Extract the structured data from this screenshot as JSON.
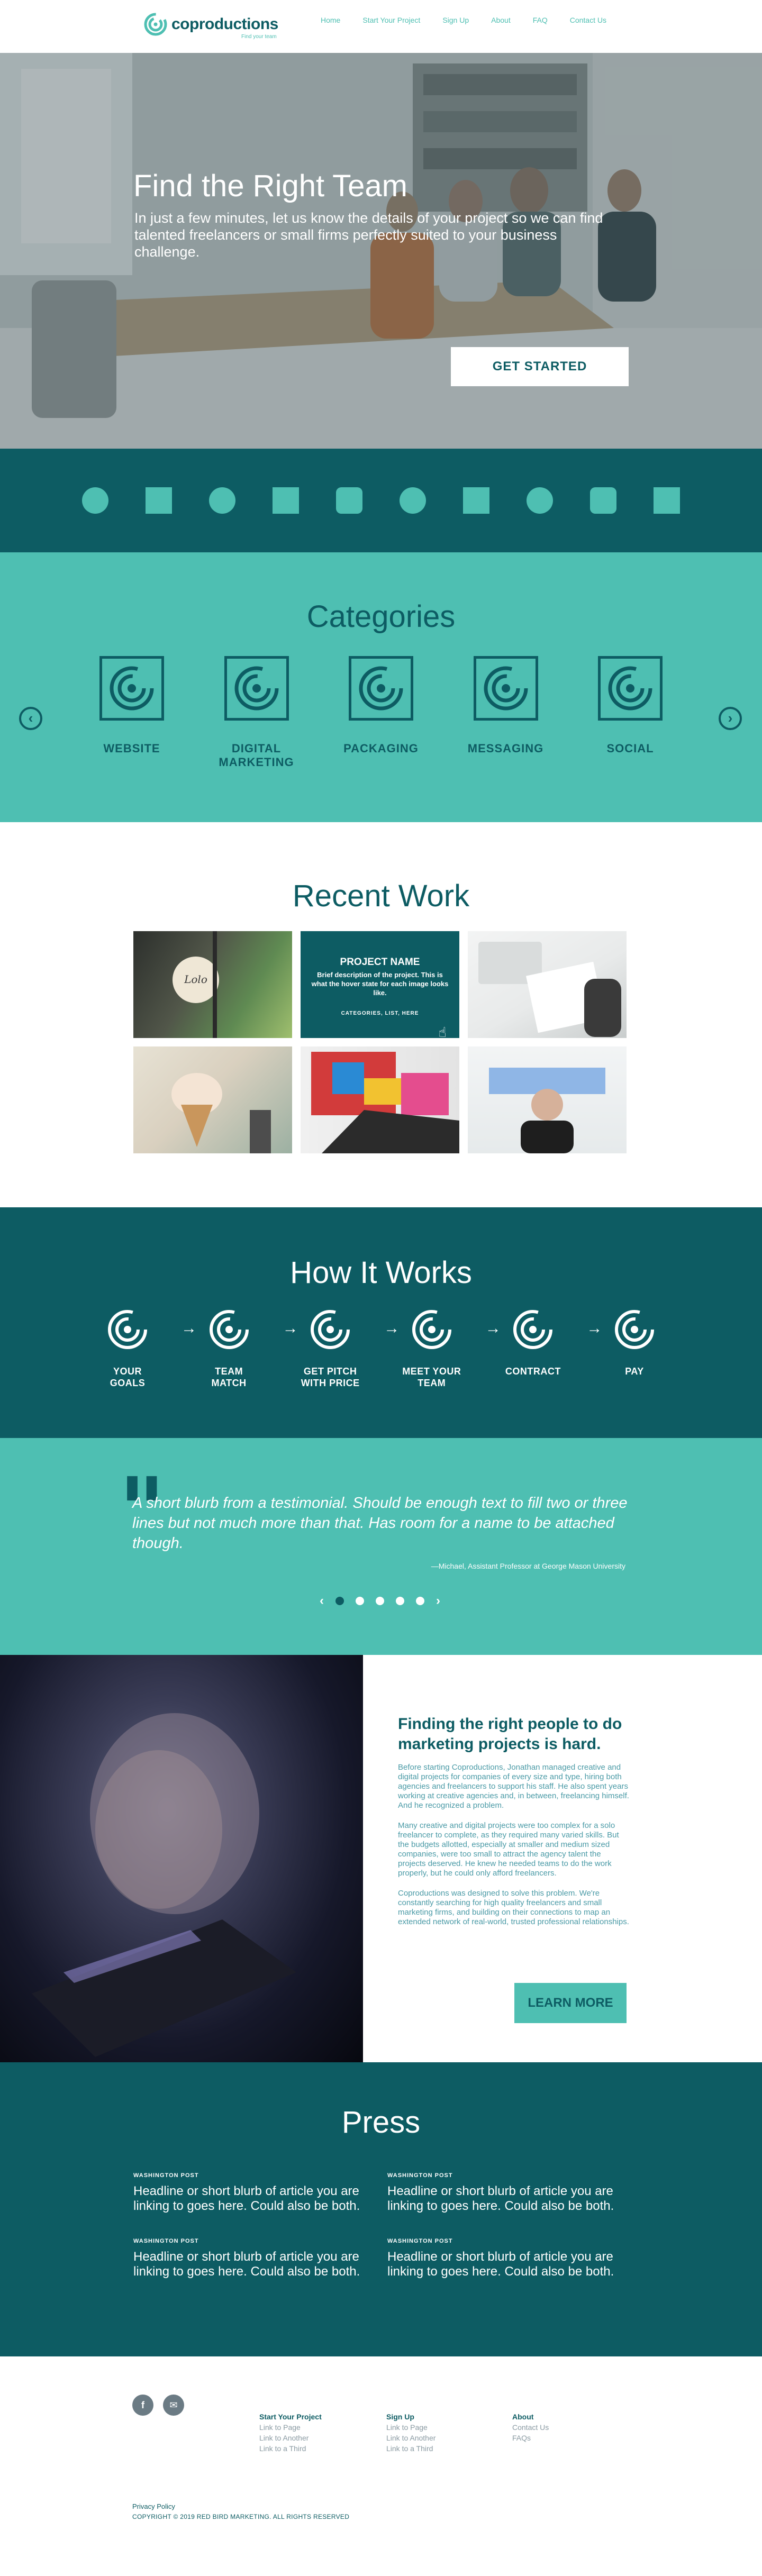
{
  "brand": {
    "name": "coproductions",
    "tagline": "Find your team",
    "color_dark": "#0d5c63",
    "color_accent": "#4ebfb2"
  },
  "nav": {
    "items": [
      "Home",
      "Start Your Project",
      "Sign Up",
      "About",
      "FAQ",
      "Contact Us"
    ]
  },
  "hero": {
    "title": "Find the Right Team",
    "subtitle": "In just a few minutes, let us know the details of your project so we can find talented freelancers or small firms perfectly suited to your business challenge.",
    "cta": "GET STARTED"
  },
  "shapes_band": {
    "icons": [
      "circle",
      "square",
      "circle",
      "square",
      "rounded-square",
      "circle",
      "square",
      "circle",
      "rounded-square",
      "square"
    ]
  },
  "categories": {
    "title": "Categories",
    "items": [
      "WEBSITE",
      "DIGITAL\nMARKETING",
      "PACKAGING",
      "MESSAGING",
      "SOCIAL"
    ],
    "prev_icon": "chevron-left-icon",
    "next_icon": "chevron-right-icon"
  },
  "recent_work": {
    "title": "Recent Work",
    "featured": {
      "name": "PROJECT NAME",
      "description": "Brief description of the project. This is what the hover state for each image looks like.",
      "categories": "CATEGORIES, LIST, HERE"
    }
  },
  "how_it_works": {
    "title": "How It Works",
    "steps": [
      "YOUR\nGOALS",
      "TEAM\nMATCH",
      "GET PITCH\nWITH PRICE",
      "MEET YOUR\nTEAM",
      "CONTRACT",
      "PAY"
    ]
  },
  "testimonial": {
    "quote": "A short blurb from a testimonial. Should be enough text to fill two or three lines but not much more than that. Has room for a name to be attached though.",
    "author": "—Michael, Assistant Professor at George Mason University",
    "slides": 5,
    "active_slide": 1
  },
  "story": {
    "title": "Finding the right people to do marketing projects is hard.",
    "paragraphs": [
      "Before starting Coproductions, Jonathan managed creative and digital projects for companies of every size and type, hiring both agencies and freelancers to support his staff. He also spent years working at creative agencies and, in between, freelancing himself. And he recognized a problem.",
      "Many creative and digital projects were too complex for a solo freelancer to complete, as they required many varied skills. But the budgets allotted, especially at smaller and medium sized companies, were too small to attract the agency talent the projects deserved. He knew he needed teams to do the work properly, but he could only afford freelancers.",
      "Coproductions was designed to solve this problem. We're constantly searching for high quality freelancers and small marketing firms, and building on their connections to map an extended network of real-world, trusted professional relationships."
    ],
    "cta": "LEARN MORE"
  },
  "press": {
    "title": "Press",
    "items": [
      {
        "source": "WASHINGTON POST",
        "headline": "Headline or short blurb of article you are linking to goes here. Could also be both."
      },
      {
        "source": "WASHINGTON POST",
        "headline": "Headline or short blurb of article you are linking to goes here. Could also be both."
      },
      {
        "source": "WASHINGTON POST",
        "headline": "Headline or short blurb of article you are linking to goes here. Could also be both."
      },
      {
        "source": "WASHINGTON POST",
        "headline": "Headline or short blurb of article you are linking to goes here. Could also be both."
      }
    ]
  },
  "footer": {
    "social": [
      "f",
      "✉"
    ],
    "columns": [
      {
        "heading": "Start Your Project",
        "links": [
          "Link to Page",
          "Link to Another",
          "Link to a Third"
        ]
      },
      {
        "heading": "Sign Up",
        "links": [
          "Link to Page",
          "Link to Another",
          "Link to a Third"
        ]
      },
      {
        "heading": "About",
        "links": [
          "Contact Us",
          "FAQs"
        ]
      }
    ],
    "privacy": "Privacy Policy",
    "copyright": "COPYRIGHT © 2019 RED BIRD MARKETING. ALL RIGHTS RESERVED"
  }
}
